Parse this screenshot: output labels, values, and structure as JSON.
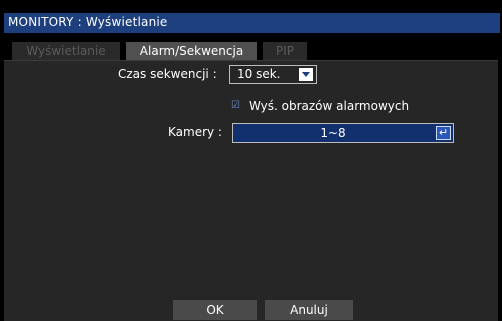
{
  "window": {
    "title": "MONITORY : Wyświetlanie"
  },
  "tabs": [
    {
      "label": "Wyświetlanie",
      "state": "inactive"
    },
    {
      "label": "Alarm/Sekwencja",
      "state": "active"
    },
    {
      "label": "PIP",
      "state": "inactive"
    }
  ],
  "form": {
    "sequence_label": "Czas sekwencji :",
    "sequence_value": "10 sek.",
    "alarm_checkbox_checked": true,
    "alarm_checkbox_label": "Wyś. obrazów alarmowych",
    "cameras_label": "Kamery :",
    "cameras_value": "1~8",
    "enter_glyph": "↵"
  },
  "buttons": {
    "ok": "OK",
    "cancel": "Anuluj"
  },
  "colors": {
    "titlebar": "#1d3f7e",
    "panel": "#262626",
    "active_tab": "#505050",
    "field": "#12306e"
  }
}
